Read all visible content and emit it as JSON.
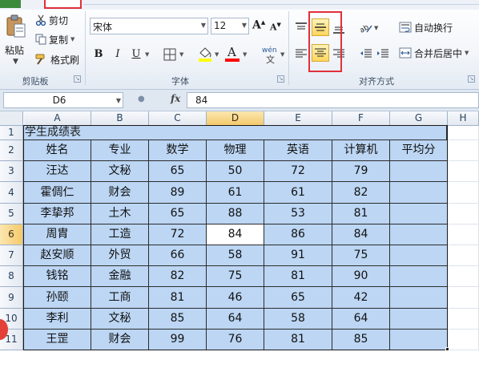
{
  "ribbon": {
    "clipboard": {
      "paste_label": "粘贴",
      "cut_label": "剪切",
      "copy_label": "复制",
      "format_painter_label": "格式刷",
      "group_label": "剪贴板"
    },
    "font": {
      "font_name": "宋体",
      "font_size": "12",
      "grow_label": "A",
      "shrink_label": "A",
      "bold_label": "B",
      "italic_label": "I",
      "underline_label": "U",
      "font_color_label": "A",
      "phonetic_label": "wén",
      "group_label": "字体",
      "highlight_color": "#ffff00",
      "font_color": "#ff0000"
    },
    "alignment": {
      "wrap_text_label": "自动换行",
      "merge_center_label": "合并后居中",
      "group_label": "对齐方式",
      "active_buttons": [
        "middle-align",
        "center-align"
      ]
    }
  },
  "formula_bar": {
    "name_box": "D6",
    "fx_label": "fx",
    "formula": "84"
  },
  "sheet": {
    "columns": [
      "A",
      "B",
      "C",
      "D",
      "E",
      "F",
      "G",
      "H"
    ],
    "rows": [
      "1",
      "2",
      "3",
      "4",
      "5",
      "6",
      "7",
      "8",
      "9",
      "10",
      "11"
    ],
    "selected_column": "D",
    "selected_row": "6",
    "active_cell": "D6",
    "fill_color": "#bcd6f4",
    "title": "学生成绩表",
    "headers": [
      "姓名",
      "专业",
      "数学",
      "物理",
      "英语",
      "计算机",
      "平均分"
    ],
    "records": [
      [
        "汪达",
        "文秘",
        "65",
        "50",
        "72",
        "79",
        ""
      ],
      [
        "霍倜仁",
        "财会",
        "89",
        "61",
        "61",
        "82",
        ""
      ],
      [
        "李挚邦",
        "土木",
        "65",
        "88",
        "53",
        "81",
        ""
      ],
      [
        "周胄",
        "工造",
        "72",
        "84",
        "86",
        "84",
        ""
      ],
      [
        "赵安顺",
        "外贸",
        "66",
        "58",
        "91",
        "75",
        ""
      ],
      [
        "钱铭",
        "金融",
        "82",
        "75",
        "81",
        "90",
        ""
      ],
      [
        "孙颐",
        "工商",
        "81",
        "46",
        "65",
        "42",
        ""
      ],
      [
        "李利",
        "文秘",
        "85",
        "64",
        "58",
        "64",
        ""
      ],
      [
        "王罡",
        "财会",
        "99",
        "76",
        "81",
        "85",
        ""
      ]
    ]
  }
}
